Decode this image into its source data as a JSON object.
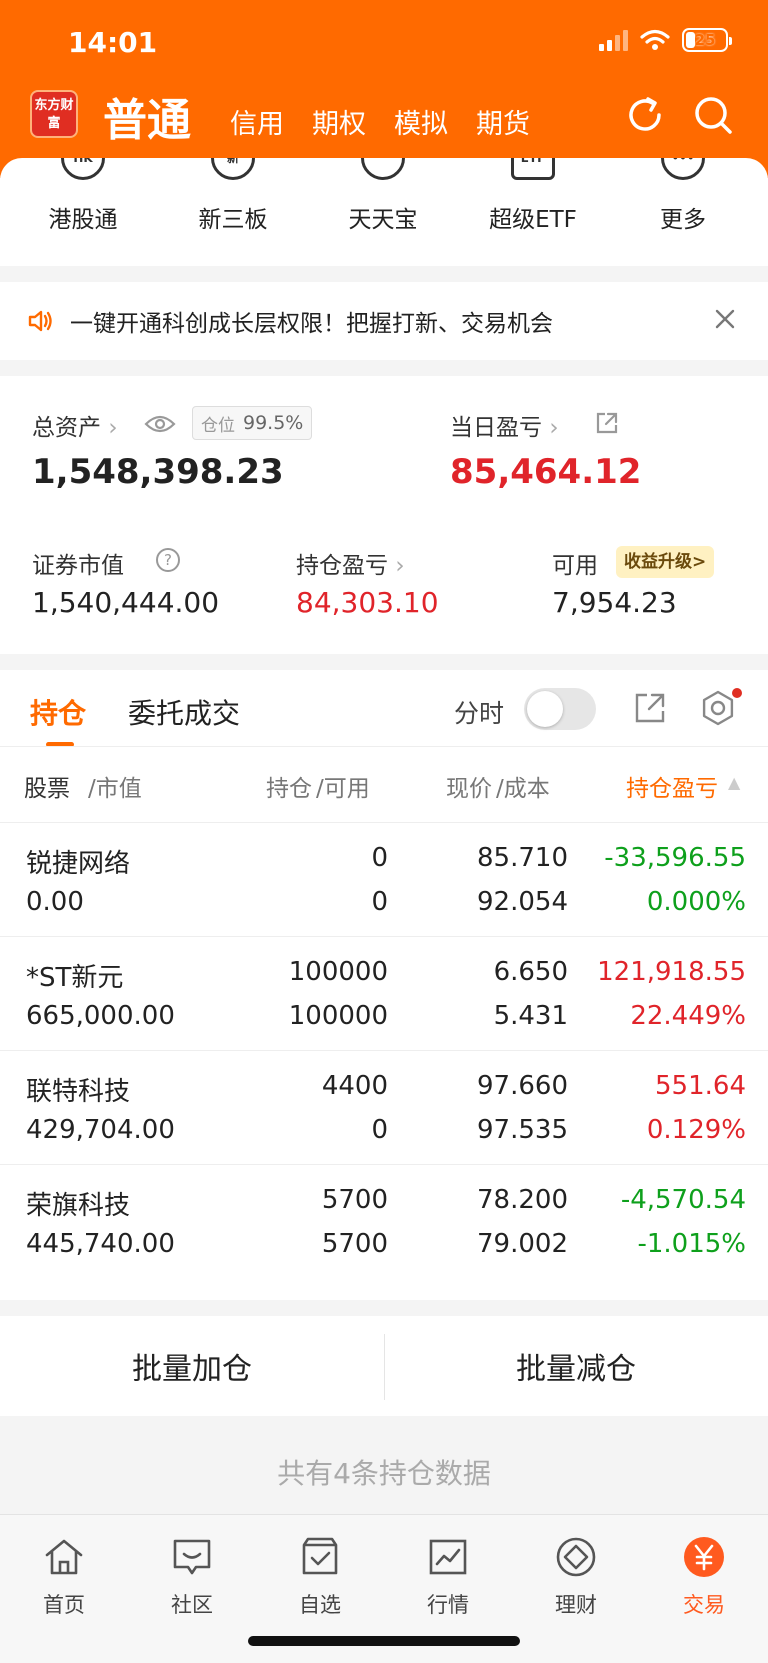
{
  "status": {
    "time": "14:01",
    "battery": "25"
  },
  "colors": {
    "brand": "#ff6a00",
    "up": "#e0242a",
    "down": "#0ea01c"
  },
  "header": {
    "logo": "东方财富",
    "main": "普通",
    "tabs": [
      "信用",
      "期权",
      "模拟",
      "期货"
    ],
    "icons": [
      "refresh-icon",
      "search-icon"
    ]
  },
  "shortcuts": [
    {
      "label": "港股通",
      "icon": "HK"
    },
    {
      "label": "新三板",
      "icon": "新"
    },
    {
      "label": "天天宝",
      "icon": "piggy-bank-icon"
    },
    {
      "label": "超级ETF",
      "icon": "ETF"
    },
    {
      "label": "更多",
      "icon": "more-icon"
    }
  ],
  "notice": {
    "text": "一键开通科创成长层权限！把握打新、交易机会"
  },
  "assets": {
    "total_label": "总资产",
    "position_key": "仓位",
    "position_value": "99.5%",
    "total_value": "1,548,398.23",
    "daily_label": "当日盈亏",
    "daily_value": "85,464.12",
    "market_label": "证券市值",
    "market_value": "1,540,444.00",
    "holding_pl_label": "持仓盈亏",
    "holding_pl_value": "84,303.10",
    "available_label": "可用",
    "upgrade_label": "收益升级>",
    "available_value": "7,954.23"
  },
  "holdings": {
    "tabs": [
      "持仓",
      "委托成交"
    ],
    "fenshi_label": "分时",
    "fenshi_on": false,
    "columns": [
      "股票",
      "/市值",
      "持仓",
      "/可用",
      "现价",
      "/成本",
      "持仓盈亏"
    ],
    "rows": [
      {
        "name": "锐捷网络",
        "market_value": "0.00",
        "position": "0",
        "available": "0",
        "price": "85.710",
        "cost": "92.054",
        "pl": "-33,596.55",
        "pl_pct": "0.000%",
        "pl_color": "down",
        "pct_color": "down"
      },
      {
        "name": "*ST新元",
        "market_value": "665,000.00",
        "position": "100000",
        "available": "100000",
        "price": "6.650",
        "cost": "5.431",
        "pl": "121,918.55",
        "pl_pct": "22.449%",
        "pl_color": "up",
        "pct_color": "up"
      },
      {
        "name": "联特科技",
        "market_value": "429,704.00",
        "position": "4400",
        "available": "0",
        "price": "97.660",
        "cost": "97.535",
        "pl": "551.64",
        "pl_pct": "0.129%",
        "pl_color": "up",
        "pct_color": "up"
      },
      {
        "name": "荣旗科技",
        "market_value": "445,740.00",
        "position": "5700",
        "available": "5700",
        "price": "78.200",
        "cost": "79.002",
        "pl": "-4,570.54",
        "pl_pct": "-1.015%",
        "pl_color": "down",
        "pct_color": "down"
      }
    ]
  },
  "batch": {
    "add": "批量加仓",
    "reduce": "批量减仓"
  },
  "footer": {
    "count_text": "共有4条持仓数据"
  },
  "bottom_nav": [
    {
      "label": "首页",
      "icon": "home-icon"
    },
    {
      "label": "社区",
      "icon": "community-icon"
    },
    {
      "label": "自选",
      "icon": "watchlist-icon"
    },
    {
      "label": "行情",
      "icon": "market-icon"
    },
    {
      "label": "理财",
      "icon": "wealth-icon"
    },
    {
      "label": "交易",
      "icon": "trade-icon",
      "active": true
    }
  ]
}
